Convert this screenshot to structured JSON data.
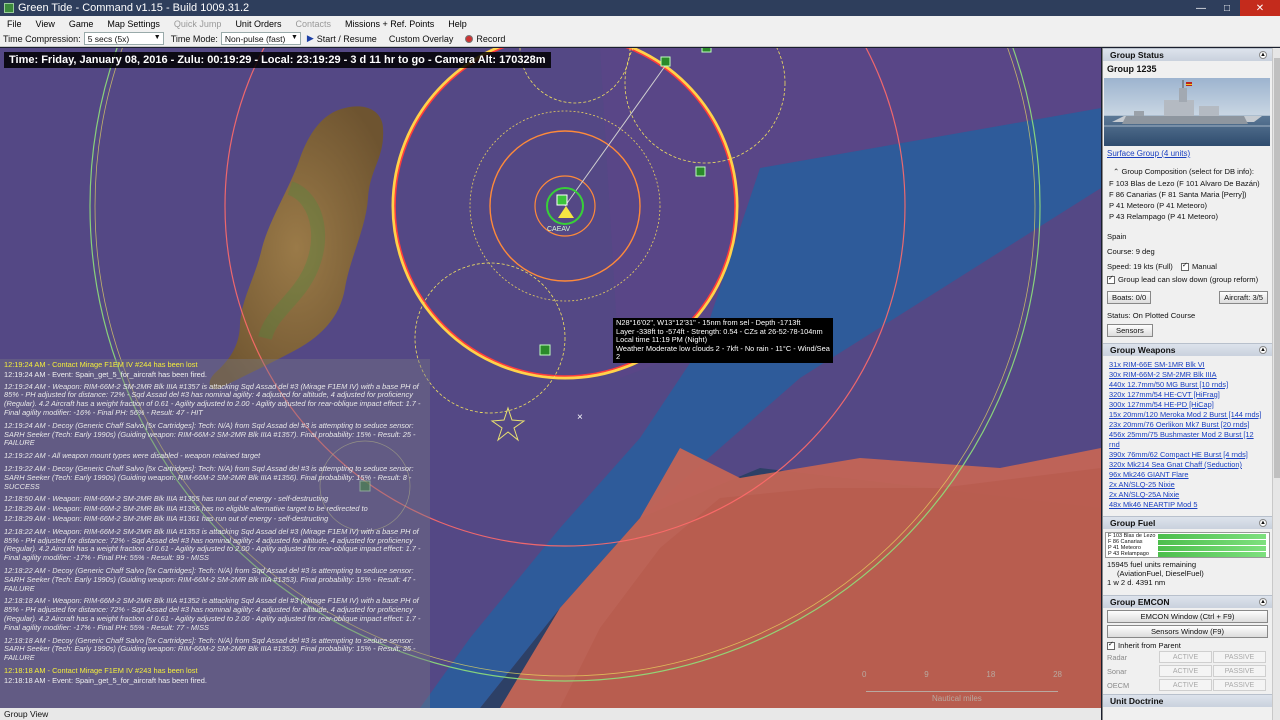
{
  "window": {
    "title": "Green Tide - Command v1.15 - Build 1009.31.2"
  },
  "menu": [
    {
      "label": "File",
      "enabled": true
    },
    {
      "label": "View",
      "enabled": true
    },
    {
      "label": "Game",
      "enabled": true
    },
    {
      "label": "Map Settings",
      "enabled": true
    },
    {
      "label": "Quick Jump",
      "enabled": false
    },
    {
      "label": "Unit Orders",
      "enabled": true
    },
    {
      "label": "Contacts",
      "enabled": false
    },
    {
      "label": "Missions + Ref. Points",
      "enabled": true
    },
    {
      "label": "Help",
      "enabled": true
    }
  ],
  "toolbar": {
    "time_compression_label": "Time Compression:",
    "time_compression_value": "5 secs (5x)",
    "time_mode_label": "Time Mode:",
    "time_mode_value": "Non-pulse (fast)",
    "start_resume": "Start / Resume",
    "custom_overlay": "Custom Overlay",
    "record": "Record"
  },
  "map": {
    "time_line": "Time: Friday, January 08, 2016 - Zulu: 00:19:29 - Local: 23:19:29 - 3 d 11 hr to go -  Camera Alt: 170328m",
    "unit_label": "CAEAV",
    "tooltip": [
      "N28°16'02\", W13°12'31\" - 15nm from sel - Depth -1713ft",
      "Layer -338ft to -574ft - Strength: 0.54 - CZs at 26-52-78-104nm",
      "Local time 11:19 PM (Night)",
      "Weather Moderate low clouds 2 - 7kft - No rain - 11°C - Wind/Sea 2"
    ],
    "scale": {
      "ticks": [
        "0",
        "9",
        "18",
        "28"
      ],
      "unit": "Nautical miles"
    }
  },
  "log": [
    {
      "type": "contact",
      "text": "12:19:24 AM - Contact Mirage F1EM IV #244 has been lost"
    },
    {
      "type": "event",
      "text": "12:19:24 AM - Event: Spain_get_5_for_aircraft has been fired."
    },
    {
      "type": "msg",
      "text": "12:19:24 AM - Weapon: RIM-66M-2 SM-2MR Blk IIIA #1357 is attacking Sqd Assad del #3 (Mirage F1EM IV) with a base PH of 85% - PH adjusted for distance: 72% - Sqd Assad del #3 has nominal agility: 4 adjusted for altitude, 4 adjusted for proficiency (Regular). 4.2 Aircraft has a weight fraction of 0.61 - Agility adjusted to 2.00 - Agility adjusted for rear-oblique impact effect: 1.7 - Final agility modifier: -16% - Final PH: 56% - Result: 47 - HIT"
    },
    {
      "type": "msg",
      "text": "12:19:24 AM - Decoy (Generic Chaff Salvo [5x Cartridges]: Tech: N/A) from Sqd Assad del #3 is attempting to seduce sensor: SARH Seeker (Tech: Early 1990s) (Guiding weapon: RIM-66M-2 SM-2MR Blk IIIA #1357). Final probability: 15% - Result: 25 - FAILURE"
    },
    {
      "type": "msg",
      "text": "12:19:22 AM - All weapon mount types were disabled - weapon retained target"
    },
    {
      "type": "msg",
      "text": "12:19:22 AM - Decoy (Generic Chaff Salvo [5x Cartridges]: Tech: N/A) from Sqd Assad del #3 is attempting to seduce sensor: SARH Seeker (Tech: Early 1990s) (Guiding weapon: RIM-66M-2 SM-2MR Blk IIIA #1356). Final probability: 15% - Result: 8 - SUCCESS"
    },
    {
      "type": "msg",
      "text": "12:18:50 AM - Weapon: RIM-66M-2 SM-2MR Blk IIIA #1355 has run out of energy - self-destructing"
    },
    {
      "type": "msg",
      "text": "12:18:29 AM - Weapon: RIM-66M-2 SM-2MR Blk IIIA #1356 has no eligible alternative target to be redirected to"
    },
    {
      "type": "msg",
      "text": "12:18:29 AM - Weapon: RIM-66M-2 SM-2MR Blk IIIA #1361 has run out of energy - self-destructing"
    },
    {
      "type": "msg",
      "text": "12:18:22 AM - Weapon: RIM-66M-2 SM-2MR Blk IIIA #1353 is attacking Sqd Assad del #3 (Mirage F1EM IV) with a base PH of 85% - PH adjusted for distance: 72% - Sqd Assad del #3 has nominal agility: 4 adjusted for altitude, 4 adjusted for proficiency (Regular). 4.2 Aircraft has a weight fraction of 0.61 - Agility adjusted to 2.00 - Agility adjusted for rear-oblique impact effect: 1.7 - Final agility modifier: -17% - Final PH: 55% - Result: 99 - MISS"
    },
    {
      "type": "msg",
      "text": "12:18:22 AM - Decoy (Generic Chaff Salvo [5x Cartridges]: Tech: N/A) from Sqd Assad del #3 is attempting to seduce sensor: SARH Seeker (Tech: Early 1990s) (Guiding weapon: RIM-66M-2 SM-2MR Blk IIIA #1353). Final probability: 15% - Result: 47 - FAILURE"
    },
    {
      "type": "msg",
      "text": "12:18:18 AM - Weapon: RIM-66M-2 SM-2MR Blk IIIA #1352 is attacking Sqd Assad del #3 (Mirage F1EM IV) with a base PH of 85% - PH adjusted for distance: 72% - Sqd Assad del #3 has nominal agility: 4 adjusted for altitude, 4 adjusted for proficiency (Regular). 4.2 Aircraft has a weight fraction of 0.61 - Agility adjusted to 2.00 - Agility adjusted for rear-oblique impact effect: 1.7 - Final agility modifier: -17% - Final PH: 55% - Result: 77 - MISS"
    },
    {
      "type": "msg",
      "text": "12:18:18 AM - Decoy (Generic Chaff Salvo [5x Cartridges]: Tech: N/A) from Sqd Assad del #3 is attempting to seduce sensor: SARH Seeker (Tech: Early 1990s) (Guiding weapon: RIM-66M-2 SM-2MR Blk IIIA #1352). Final probability: 15% - Result: 35 - FAILURE"
    },
    {
      "type": "contact",
      "text": "12:18:18 AM - Contact Mirage F1EM IV #243 has been lost"
    },
    {
      "type": "event",
      "text": "12:18:18 AM - Event: Spain_get_5_for_aircraft has been fired."
    }
  ],
  "statusbar": {
    "text": "Group View"
  },
  "panel": {
    "group_status": {
      "header": "Group Status",
      "name": "Group 1235",
      "type_link": "Surface Group (4 units)",
      "composition_label": "Group Composition (select for DB info):",
      "members": [
        "F 103 Blas de Lezo (F 101 Alvaro De Bazán)",
        "F 86 Canarias (F 81 Santa Maria [Perry])",
        "P 41 Meteoro (P 41 Meteoro)",
        "P 43 Relampago (P 41 Meteoro)"
      ],
      "side": "Spain",
      "course": "Course: 9 deg",
      "speed": "Speed: 19 kts (Full)",
      "manual": "Manual",
      "group_lead": "Group lead can slow down (group reform)",
      "boats_btn": "Boats: 0/0",
      "aircraft_btn": "Aircraft: 3/5",
      "status": "Status: On Plotted Course",
      "sensors_btn": "Sensors"
    },
    "weapons": {
      "header": "Group Weapons",
      "items": [
        "31x RIM-66E SM-1MR Blk VI",
        "30x RIM-66M-2 SM-2MR Blk IIIA",
        "440x 12.7mm/50 MG Burst [10 rnds]",
        "320x 127mm/54 HE-CVT [HiFrag]",
        "300x 127mm/54 HE-PD [HiCap]",
        "15x 20mm/120 Meroka Mod 2 Burst [144 rnds]",
        "23x 20mm/76 Oerlikon Mk7 Burst [20 rnds]",
        "456x 25mm/75 Bushmaster Mod 2 Burst [12 rnd",
        "390x 76mm/62 Compact HE Burst [4 rnds]",
        "320x Mk214 Sea Gnat Chaff (Seduction)",
        "96x Mk246 GIANT Flare",
        "2x AN/SLQ-25 Nixie",
        "2x AN/SLQ-25A Nixie",
        "48x Mk46 NEARTIP Mod 5"
      ]
    },
    "fuel": {
      "header": "Group Fuel",
      "ships": [
        {
          "name": "F 103 Blas de Lezo",
          "level": 1.0
        },
        {
          "name": "F 86 Canarias",
          "level": 1.0
        },
        {
          "name": "P 41 Meteoro",
          "level": 1.0
        },
        {
          "name": "P 43 Relampago",
          "level": 1.0
        }
      ],
      "remaining": "15945 fuel units remaining",
      "fuel_types": "(AviationFuel, DieselFuel)",
      "endurance": "1 w 2 d. 4391 nm"
    },
    "emcon": {
      "header": "Group EMCON",
      "emcon_btn": "EMCON Window (Ctrl + F9)",
      "sensors_btn": "Sensors Window (F9)",
      "inherit": "Inherit from Parent",
      "rows": [
        {
          "name": "Radar",
          "active": "ACTIVE",
          "passive": "PASSIVE"
        },
        {
          "name": "Sonar",
          "active": "ACTIVE",
          "passive": "PASSIVE"
        },
        {
          "name": "OECM",
          "active": "ACTIVE",
          "passive": "PASSIVE"
        }
      ]
    },
    "doctrine_header": "Unit Doctrine"
  },
  "colors": {
    "sea": "#2c3f62",
    "land": "#8b6a3e",
    "friendly_zone": "#6a4d8a",
    "hostile_zone": "#c96a5a",
    "range_red": "#ff3d3d",
    "range_yellow": "#f2e24a",
    "range_green": "#8fe07a"
  }
}
